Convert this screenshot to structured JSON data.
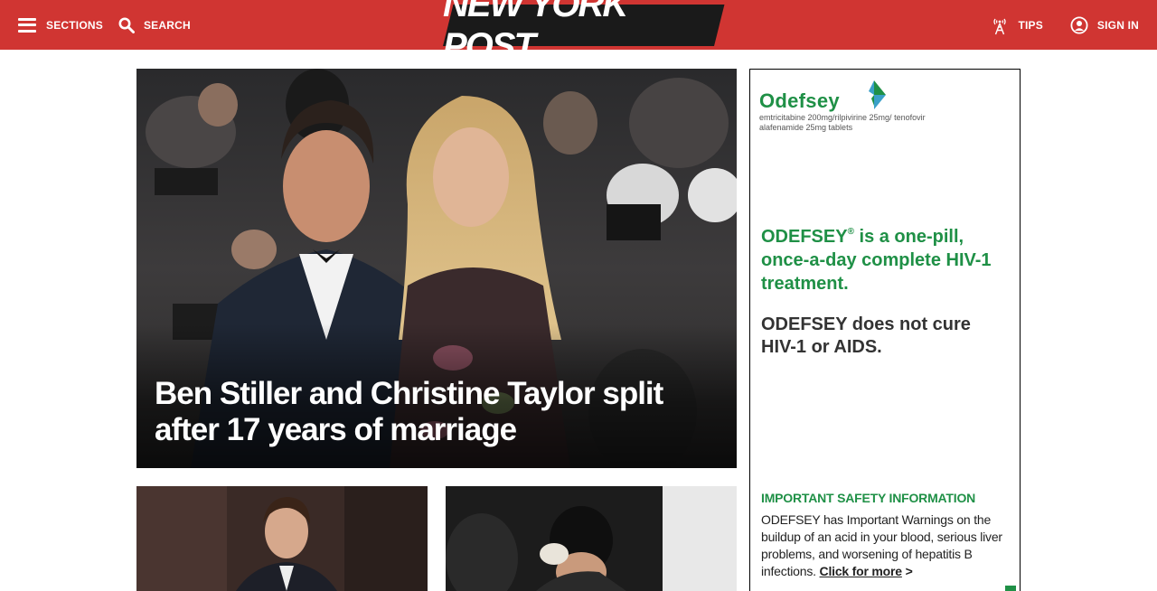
{
  "header": {
    "sections_label": "SECTIONS",
    "search_label": "SEARCH",
    "logo_text": "NEW YORK POST",
    "tips_label": "TIPS",
    "signin_label": "SIGN IN",
    "brand_color": "#d03532"
  },
  "hero": {
    "headline": "Ben Stiller and Christine Taylor split after 17 years of marriage"
  },
  "thumbs": [
    {
      "icon": "photo-man-suit"
    },
    {
      "icon": "photo-person-head-down"
    }
  ],
  "ad": {
    "brand_name": "Odefsey",
    "generic_name": "emtricitabine 200mg/rilpivirine 25mg/ tenofovir alafenamide 25mg tablets",
    "claim_brand": "ODEFSEY",
    "claim_mark": "®",
    "claim_rest": " is a one-pill, once-a-day complete HIV-1 treatment.",
    "cure_text": "ODEFSEY does not cure HIV-1 or AIDS.",
    "isi_title": "IMPORTANT SAFETY INFORMATION",
    "isi_body": "ODEFSEY has Important Warnings on the buildup of an acid in your blood, serious liver problems, and worsening of hepatitis B infections. ",
    "isi_link": "Click for more",
    "isi_arrow": " >",
    "accent_color": "#1f9046"
  }
}
